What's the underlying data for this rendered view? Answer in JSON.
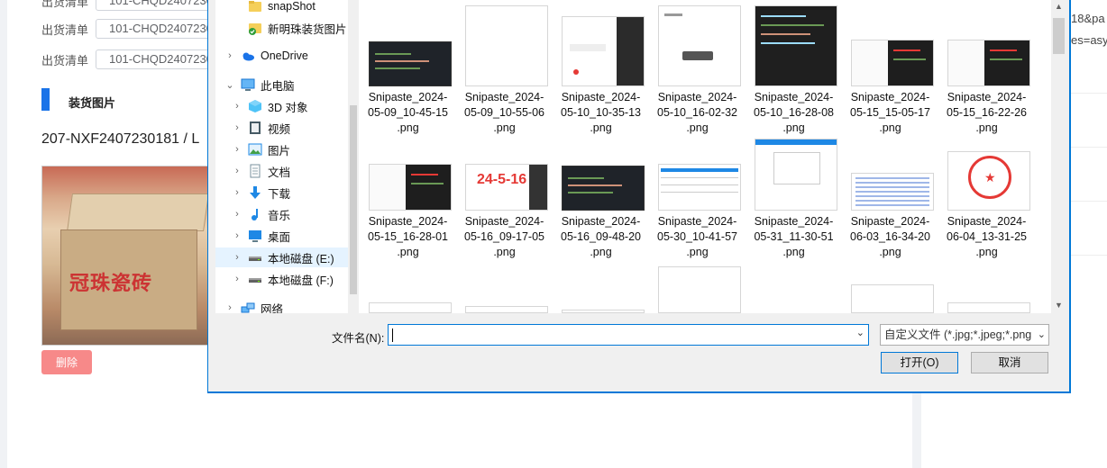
{
  "background_page": {
    "rows": [
      {
        "label": "出货清单",
        "value": "101-CHQD2407230"
      },
      {
        "label": "出货清单",
        "value": "101-CHQD2407230"
      },
      {
        "label": "出货清单",
        "value": "101-CHQD2407230"
      }
    ],
    "section_title": "装货图片",
    "order_line": "207-NXF2407230181 / L",
    "photo_brand": "冠珠瓷砖",
    "delete_label": "删除",
    "right_fragments": [
      "18&pa",
      "es=asy"
    ]
  },
  "dialog": {
    "nav": [
      {
        "label": "snapShot",
        "icon": "folder-icon",
        "indent": 1,
        "chevron": ""
      },
      {
        "label": "新明珠装货图片",
        "icon": "synced-folder-icon",
        "indent": 1,
        "chevron": ""
      },
      {
        "label": "OneDrive",
        "icon": "cloud-icon",
        "indent": 0,
        "chevron": "›"
      },
      {
        "label": "此电脑",
        "icon": "computer-icon",
        "indent": 0,
        "chevron": "⌄"
      },
      {
        "label": "3D 对象",
        "icon": "cube-icon",
        "indent": 1,
        "chevron": "›"
      },
      {
        "label": "视频",
        "icon": "video-icon",
        "indent": 1,
        "chevron": "›"
      },
      {
        "label": "图片",
        "icon": "picture-icon",
        "indent": 1,
        "chevron": "›"
      },
      {
        "label": "文档",
        "icon": "document-icon",
        "indent": 1,
        "chevron": "›"
      },
      {
        "label": "下载",
        "icon": "download-icon",
        "indent": 1,
        "chevron": "›"
      },
      {
        "label": "音乐",
        "icon": "music-icon",
        "indent": 1,
        "chevron": "›"
      },
      {
        "label": "桌面",
        "icon": "desktop-icon",
        "indent": 1,
        "chevron": "›"
      },
      {
        "label": "本地磁盘 (E:)",
        "icon": "drive-icon",
        "indent": 1,
        "chevron": "›",
        "selected": true
      },
      {
        "label": "本地磁盘 (F:)",
        "icon": "drive-icon",
        "indent": 1,
        "chevron": "›"
      },
      {
        "label": "网络",
        "icon": "network-icon",
        "indent": 0,
        "chevron": "›"
      }
    ],
    "files": [
      {
        "line1": "Snipaste_2024-",
        "line2": "05-09_10-45-15",
        "line3": ".png",
        "style": "dark"
      },
      {
        "line1": "Snipaste_2024-",
        "line2": "05-09_10-55-06",
        "line3": ".png",
        "style": "blank"
      },
      {
        "line1": "Snipaste_2024-",
        "line2": "05-10_10-35-13",
        "line3": ".png",
        "style": "mobile"
      },
      {
        "line1": "Snipaste_2024-",
        "line2": "05-10_16-02-32",
        "line3": ".png",
        "style": "mobile-light"
      },
      {
        "line1": "Snipaste_2024-",
        "line2": "05-10_16-28-08",
        "line3": ".png",
        "style": "dark-tall"
      },
      {
        "line1": "Snipaste_2024-",
        "line2": "05-15_15-05-17",
        "line3": ".png",
        "style": "code"
      },
      {
        "line1": "Snipaste_2024-",
        "line2": "05-15_16-22-26",
        "line3": ".png",
        "style": "code"
      },
      {
        "line1": "Snipaste_2024-",
        "line2": "05-15_16-28-01",
        "line3": ".png",
        "style": "code"
      },
      {
        "line1": "Snipaste_2024-",
        "line2": "05-16_09-17-05",
        "line3": ".png",
        "style": "red-text"
      },
      {
        "line1": "Snipaste_2024-",
        "line2": "05-16_09-48-20",
        "line3": ".png",
        "style": "dark"
      },
      {
        "line1": "Snipaste_2024-",
        "line2": "05-30_10-41-57",
        "line3": ".png",
        "style": "table"
      },
      {
        "line1": "Snipaste_2024-",
        "line2": "05-31_11-30-51",
        "line3": ".png",
        "style": "form"
      },
      {
        "line1": "Snipaste_2024-",
        "line2": "06-03_16-34-20",
        "line3": ".png",
        "style": "blue-text"
      },
      {
        "line1": "Snipaste_2024-",
        "line2": "06-04_13-31-25",
        "line3": ".png",
        "style": "seal"
      }
    ],
    "filename_label": "文件名(N):",
    "filename_value": "",
    "filetype_value": "自定义文件 (*.jpg;*.jpeg;*.png",
    "open_label": "打开(O)",
    "cancel_label": "取消",
    "colors": {
      "accent": "#0078d7",
      "selected_bg": "#e5f3ff",
      "delete": "#f78989",
      "section_bar": "#1a73e8"
    }
  }
}
